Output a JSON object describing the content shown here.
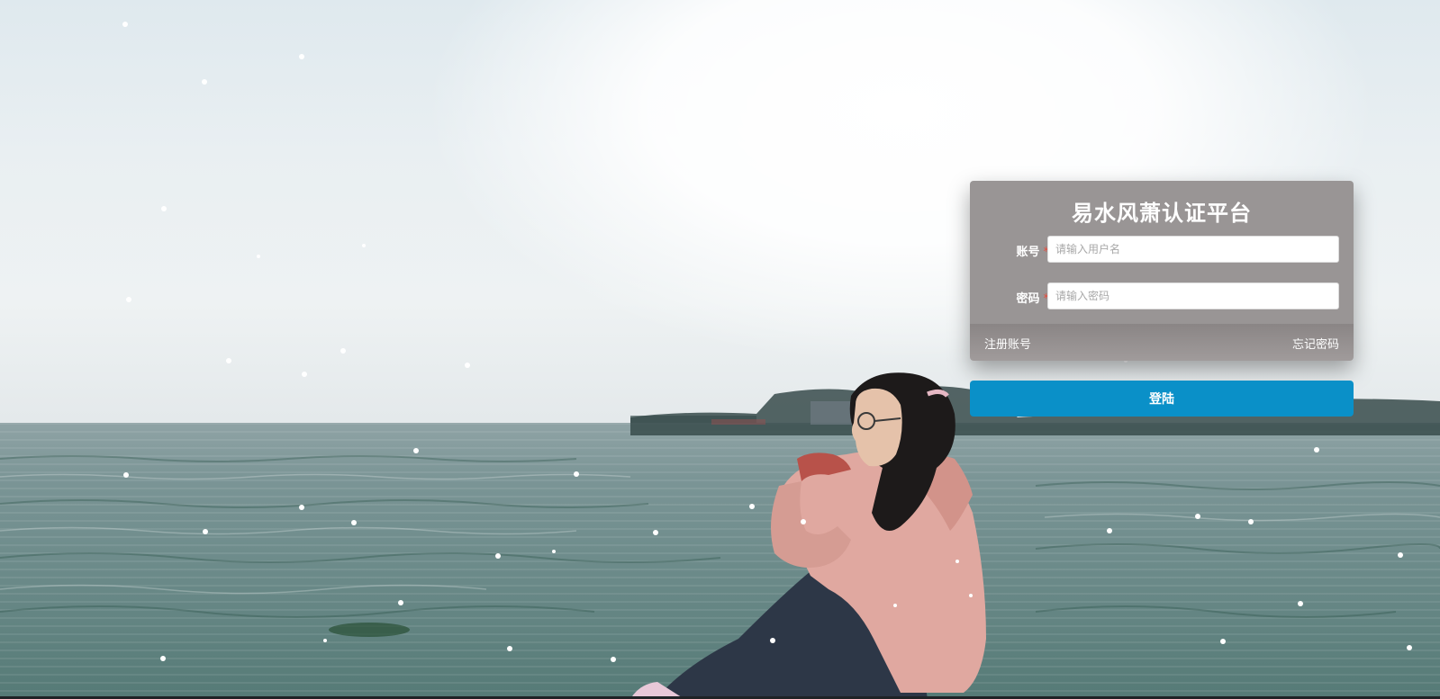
{
  "login": {
    "title": "易水风萧认证平台",
    "account_label": "账号",
    "account_placeholder": "请输入用户名",
    "password_label": "密码",
    "password_placeholder": "请输入密码",
    "required_mark": "*",
    "register_link": "注册账号",
    "forgot_link": "忘记密码",
    "submit_label": "登陆"
  },
  "colors": {
    "accent": "#0a90c8",
    "panel": "#969292",
    "required": "#e84c3d"
  }
}
